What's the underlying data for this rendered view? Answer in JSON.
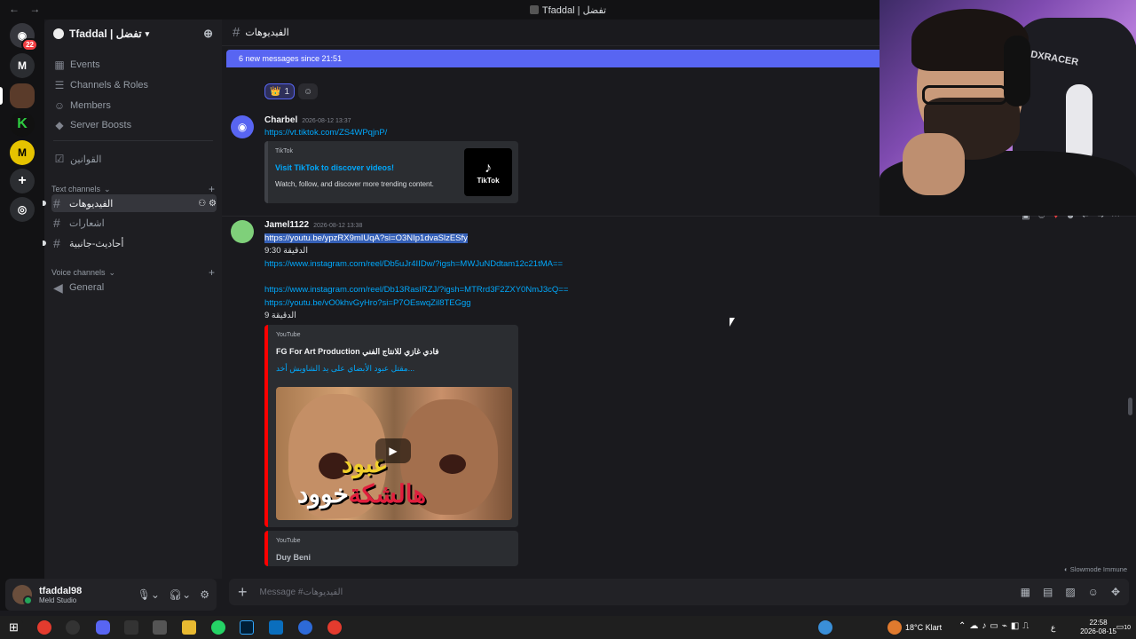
{
  "window": {
    "title": "Tfaddal | تفضل",
    "nav_back": "←",
    "nav_forward": "→"
  },
  "rail": {
    "dm_badge": "22",
    "m_label": "M"
  },
  "server": {
    "name": "Tfaddal | تفضل",
    "items": [
      {
        "icon": "calendar-icon",
        "label": "Events"
      },
      {
        "icon": "channels-icon",
        "label": "Channels & Roles"
      },
      {
        "icon": "members-icon",
        "label": "Members"
      },
      {
        "icon": "boost-icon",
        "label": "Server Boosts"
      }
    ],
    "rules_channel": "القوانين",
    "text_category": "Text channels",
    "text_channels": [
      {
        "name": "الفيديوهات",
        "active": true
      },
      {
        "name": "اشعارات",
        "active": false
      },
      {
        "name": "أحاديث-جانبية",
        "active": false
      }
    ],
    "voice_category": "Voice channels",
    "voice_channels": [
      {
        "name": "General"
      }
    ]
  },
  "user": {
    "name": "tfaddal98",
    "status": "Meld Studio"
  },
  "chat": {
    "channel": "الفيديوهات",
    "new_messages": "6 new messages since 21:51",
    "reactions": [
      {
        "emoji": "👑",
        "count": "1"
      }
    ],
    "messages": [
      {
        "author": "Charbel",
        "time": "2026-08-12 13:37",
        "link": "https://vt.tiktok.com/ZS4WPqjnP/",
        "embed": {
          "provider": "TikTok",
          "title": "Visit TikTok to discover videos!",
          "description": "Watch, follow, and discover more trending content.",
          "thumb_label": "TikTok"
        }
      },
      {
        "author": "Jamel1122",
        "time": "2026-08-12 13:38",
        "lines": [
          "https://youtu.be/ypzRX9mIUqA?si=O3NIp1dvaSlzESfy",
          "الدقيقة 9:30",
          "https://www.instagram.com/reel/Db5uJr4IIDw/?igsh=MWJuNDdtam12c21tMA==",
          "https://www.instagram.com/reel/Db13RasIRZJ/?igsh=MTRrd3F2ZXY0NmJ3cQ==",
          "https://youtu.be/vO0khvGyHro?si=P7OEswqZil8TEGgg",
          "الدقيقة 9"
        ],
        "embed": {
          "provider": "YouTube",
          "author": "FG For Art Production فادي غازي للانتاج الفني",
          "title": "مقتل عبود الأبضاي على يد الشاويش أخد...",
          "caption_top": "عبود",
          "caption_bottom_white": "خوود ",
          "caption_bottom_red": "هالشكة"
        },
        "embed2": {
          "provider": "YouTube",
          "author": "Duy Beni"
        }
      }
    ],
    "placeholder": "Message #الفيديوهات",
    "slowmode": "Slowmode Immune"
  },
  "taskbar": {
    "weather": "18°C  Klart",
    "time": "22:58",
    "date": "2026-08-15",
    "lang": "ع",
    "notif_count": "10"
  }
}
